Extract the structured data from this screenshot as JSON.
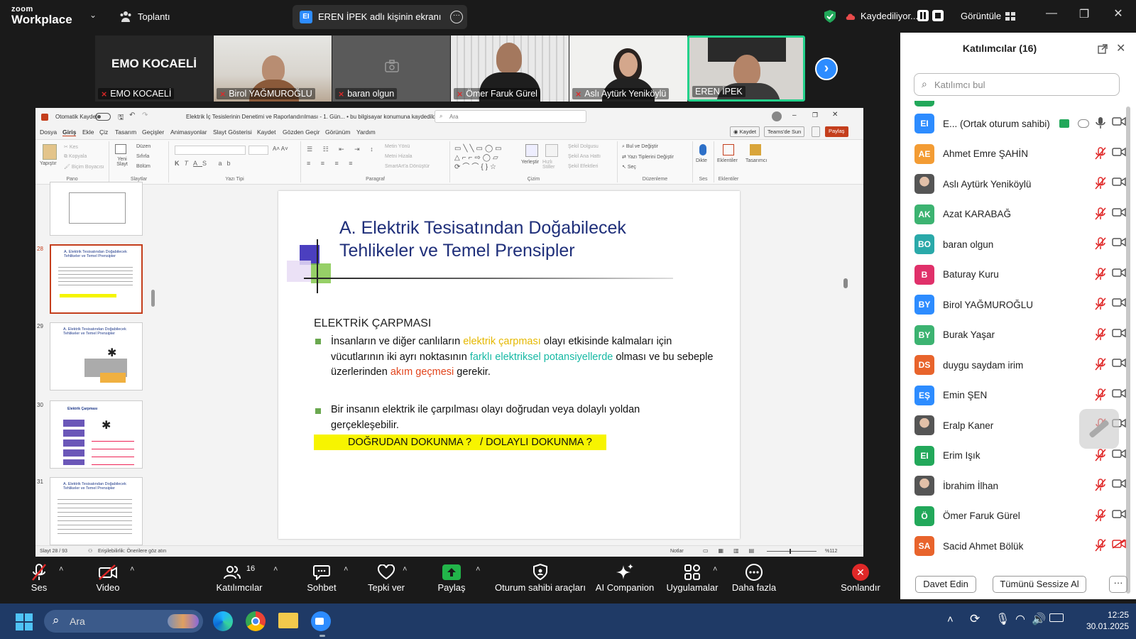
{
  "app": {
    "logo_top": "zoom",
    "logo_bottom": "Workplace",
    "meeting_label": "Toplantı"
  },
  "share_banner": {
    "badge": "EI",
    "text": "EREN İPEK adlı kişinin ekranı"
  },
  "recording": {
    "label": "Kaydediliyor...",
    "view_label": "Görüntüle"
  },
  "video_tiles": [
    {
      "name": "EMO KOCAELİ",
      "big_label": "EMO KOCAELİ"
    },
    {
      "name": "Birol YAĞMUROĞLU"
    },
    {
      "name": "baran olgun"
    },
    {
      "name": "Ömer Faruk Gürel"
    },
    {
      "name": "Aslı Aytürk Yeniköylü"
    },
    {
      "name": "EREN İPEK"
    }
  ],
  "ppt": {
    "autosave": "Otomatik Kaydet",
    "file_title": "Elektrik İç Tesislerinin Denetimi ve Raporlandırılması - 1. Gün... • bu bilgisayar konumuna kaydedildi",
    "search_placeholder": "Ara",
    "tabs": [
      "Dosya",
      "Giriş",
      "Ekle",
      "Çiz",
      "Tasarım",
      "Geçişler",
      "Animasyonlar",
      "Slayt Gösterisi",
      "Kaydet",
      "Gözden Geçir",
      "Görünüm",
      "Yardım"
    ],
    "record_btn": "Kaydet",
    "teams_btn": "Teams'de Sun",
    "share_btn": "Paylaş",
    "ribbon_groups": [
      "Pano",
      "Slaytlar",
      "Yazı Tipi",
      "Paragraf",
      "Çizim",
      "Düzenleme",
      "Ses",
      "Eklentiler"
    ],
    "ribbon_items": {
      "paste": "Yapıştır",
      "cut": "Kes",
      "copy": "Kopyala",
      "format_painter": "Biçim Boyacısı",
      "new_slide": "Yeni Slayt",
      "layout": "Düzen",
      "reset": "Sıfırla",
      "section": "Bölüm",
      "text_direction": "Metin Yönü",
      "align_text": "Metni Hizala",
      "smartart": "SmartArt'a Dönüştür",
      "arrange": "Yerleştir",
      "quick_styles": "Hızlı Stiller",
      "shape_fill": "Şekil Dolgusu",
      "shape_outline": "Şekil Ana Hattı",
      "shape_effects": "Şekil Efektleri",
      "find_replace": "Bul ve Değiştir",
      "replace_fonts": "Yazı Tiplerini Değiştir",
      "select": "Seç",
      "dictate": "Dikte",
      "addins": "Eklentiler",
      "designer": "Tasarımcı"
    },
    "thumb_numbers": [
      "28",
      "29",
      "30",
      "31"
    ],
    "thumb_titles": [
      "A. Elektrik Tesisatından Doğabilecek Tehlikeler ve Temel Prensipler",
      "A. Elektrik Tesisatından Doğabilecek Tehlikeler ve Temel Prensipler",
      "Elektrik Çarpması",
      "A. Elektrik Tesisatından Doğabilecek Tehlikeler ve Temel Prensipler"
    ],
    "slide": {
      "title_line1": "A. Elektrik Tesisatından Doğabilecek",
      "title_line2": "Tehlikeler ve Temel Prensipler",
      "heading": "ELEKTRİK ÇARPMASI",
      "b1_a": "İnsanların ve diğer canlıların ",
      "b1_hl1": "elektrik çarpması",
      "b1_b": " olayı etkisinde kalmaları için vücutlarının iki ayrı noktasının ",
      "b1_hl2": "farklı elektriksel potansiyellerde",
      "b1_c": " olması ve bu sebeple üzerlerinden ",
      "b1_hl3": "akım geçmesi",
      "b1_d": " gerekir.",
      "b2": "Bir insanın elektrik ile çarpılması olayı doğrudan veya dolaylı yoldan gerçekleşebilir.",
      "banner": "DOĞRUDAN DOKUNMA ?   / DOLAYLI DOKUNMA ?"
    },
    "status_slide": "Slayt 28 / 93",
    "status_access": "Erişilebilirlik: Önerilere göz atın",
    "status_notes": "Notlar",
    "status_zoom": "%112"
  },
  "participants": {
    "title": "Katılımcılar (16)",
    "search_placeholder": "Katılımcı bul",
    "list": [
      {
        "initials": "EI",
        "name": "E... (Ortak oturum sahibi)",
        "color": "#2d8cff"
      },
      {
        "initials": "AE",
        "name": "Ahmet Emre ŞAHİN",
        "color": "#f39c34"
      },
      {
        "initials": "",
        "name": "Aslı Aytürk Yeniköylü",
        "color": "#8a6a5a"
      },
      {
        "initials": "AK",
        "name": "Azat KARABAĞ",
        "color": "#3cb371"
      },
      {
        "initials": "BO",
        "name": "baran olgun",
        "color": "#2aa9a9"
      },
      {
        "initials": "B",
        "name": "Baturay Kuru",
        "color": "#e0306a"
      },
      {
        "initials": "BY",
        "name": "Birol YAĞMUROĞLU",
        "color": "#2d8cff"
      },
      {
        "initials": "BY",
        "name": "Burak Yaşar",
        "color": "#3cb371"
      },
      {
        "initials": "DS",
        "name": "duygu saydam irim",
        "color": "#e8642c"
      },
      {
        "initials": "EŞ",
        "name": "Emin ŞEN",
        "color": "#2d8cff"
      },
      {
        "initials": "",
        "name": "Eralp Kaner",
        "color": "#c9a58c"
      },
      {
        "initials": "EI",
        "name": "Erim Işık",
        "color": "#22a85a"
      },
      {
        "initials": "",
        "name": "İbrahim İlhan",
        "color": "#777777"
      },
      {
        "initials": "Ö",
        "name": "Ömer Faruk Gürel",
        "color": "#22a85a"
      },
      {
        "initials": "SA",
        "name": "Sacid Ahmet Bölük",
        "color": "#e8642c"
      }
    ],
    "invite_btn": "Davet Edin",
    "mute_all_btn": "Tümünü Sessize Al"
  },
  "toolbar": {
    "audio": "Ses",
    "video": "Video",
    "participants": "Katılımcılar",
    "participants_count": "16",
    "chat": "Sohbet",
    "react": "Tepki ver",
    "share": "Paylaş",
    "host_tools": "Oturum sahibi araçları",
    "ai": "AI Companion",
    "apps": "Uygulamalar",
    "more": "Daha fazla",
    "end": "Sonlandır"
  },
  "taskbar": {
    "search": "Ara",
    "time": "12:25",
    "date": "30.01.2025"
  }
}
